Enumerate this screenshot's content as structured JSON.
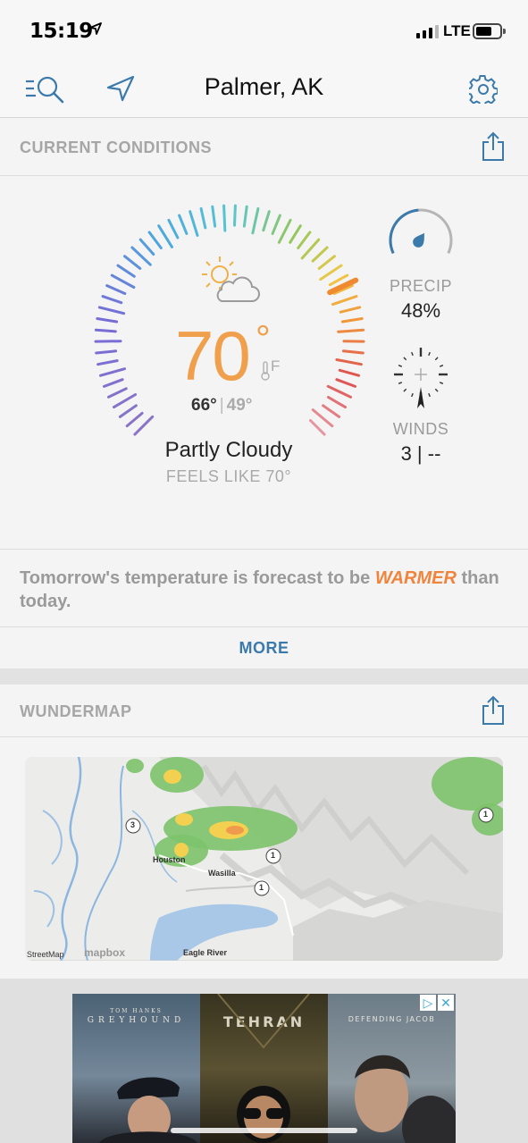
{
  "status_bar": {
    "time": "15:19",
    "network": "LTE"
  },
  "nav": {
    "title": "Palmer, AK"
  },
  "current_conditions": {
    "header": "CURRENT CONDITIONS",
    "temperature": "70",
    "degree_symbol": "°",
    "unit": "F",
    "high": "66°",
    "separator": "|",
    "low": "49°",
    "condition": "Partly Cloudy",
    "feels_like": "FEELS LIKE 70°",
    "precip_label": "PRECIP",
    "precip_value": "48%",
    "precip_fraction": 0.48,
    "winds_label": "WINDS",
    "winds_value": "3 | --"
  },
  "forecast_note": {
    "text_before": "Tomorrow's temperature is forecast to be ",
    "highlight": "WARMER",
    "text_after": " than today."
  },
  "more_link": "MORE",
  "wundermap": {
    "header": "WUNDERMAP",
    "labels": {
      "houston": "Houston",
      "wasilla": "Wasilla",
      "eagle_river": "Eagle River"
    },
    "route_markers": [
      "3",
      "1",
      "1",
      "1"
    ],
    "credit_streetmap": "StreetMap",
    "credit_mapbox": "mapbox"
  },
  "ad": {
    "posters": [
      {
        "top_text": "TOM HANKS",
        "title": "GREYHOUND"
      },
      {
        "title": "TEHRAN"
      },
      {
        "title": "DEFENDING JACOB"
      }
    ]
  },
  "colors": {
    "accent_blue": "#3b7aab",
    "temperature_orange": "#f0a04c",
    "warmer_orange": "#f0843c"
  }
}
